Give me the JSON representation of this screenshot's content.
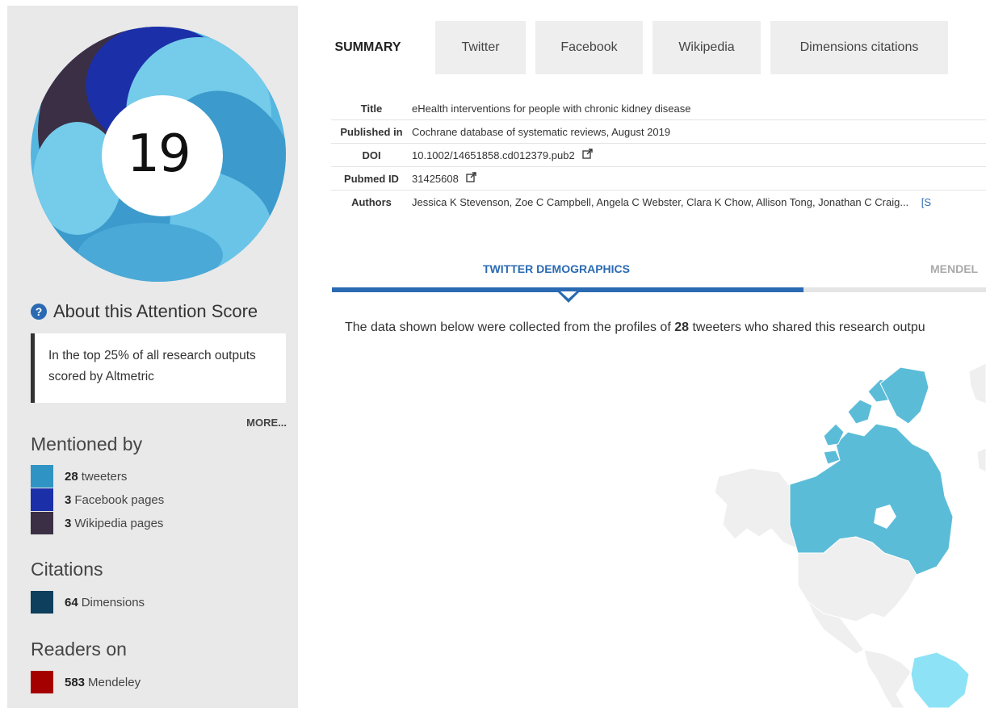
{
  "score": {
    "value": "19",
    "about_label": "About this Attention Score",
    "callout": "In the top 25% of all research outputs scored by Altmetric",
    "more_label": "MORE...",
    "ring_colors": [
      "#74cbea",
      "#3c9bcc",
      "#1b2fa8",
      "#3b2f45"
    ]
  },
  "mentioned_by": {
    "title": "Mentioned by",
    "items": [
      {
        "count": "28",
        "label": "tweeters",
        "color": "#2f94c3"
      },
      {
        "count": "3",
        "label": "Facebook pages",
        "color": "#1b2fa8"
      },
      {
        "count": "3",
        "label": "Wikipedia pages",
        "color": "#3b2f45"
      }
    ]
  },
  "citations": {
    "title": "Citations",
    "items": [
      {
        "count": "64",
        "label": "Dimensions",
        "color": "#0e3f5c"
      }
    ]
  },
  "readers": {
    "title": "Readers on",
    "items": [
      {
        "count": "583",
        "label": "Mendeley",
        "color": "#a50000"
      }
    ]
  },
  "tabs": [
    {
      "label": "SUMMARY",
      "active": true
    },
    {
      "label": "Twitter"
    },
    {
      "label": "Facebook"
    },
    {
      "label": "Wikipedia"
    },
    {
      "label": "Dimensions citations"
    }
  ],
  "meta": {
    "title_label": "Title",
    "title": "eHealth interventions for people with chronic kidney disease",
    "published_label": "Published in",
    "published": "Cochrane database of systematic reviews, August 2019",
    "doi_label": "DOI",
    "doi": "10.1002/14651858.cd012379.pub2",
    "pubmed_label": "Pubmed ID",
    "pubmed": "31425608",
    "authors_label": "Authors",
    "authors": "Jessica K Stevenson, Zoe C Campbell, Angela C Webster, Clara K Chow, Allison Tong, Jonathan C Craig...",
    "authors_more": "[S"
  },
  "subtabs": {
    "twitter": "TWITTER DEMOGRAPHICS",
    "mendeley": "MENDEL"
  },
  "data_info": {
    "prefix": "The data shown below were collected from the profiles of ",
    "count": "28",
    "suffix": " tweeters who shared this research outpu"
  },
  "map_colors": {
    "highlight": "#5bbcd8",
    "light": "#8de3f5",
    "base": "#efefef"
  }
}
